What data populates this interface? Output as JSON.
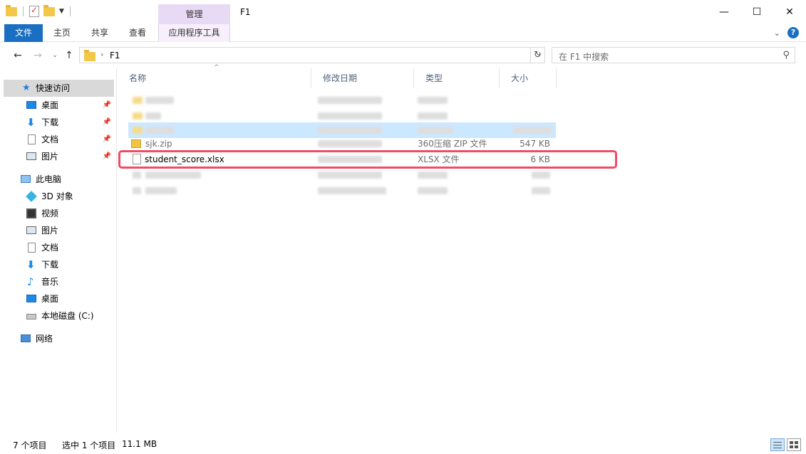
{
  "window": {
    "title": "F1",
    "manage_tab": "管理",
    "minimize": "—",
    "maximize": "☐",
    "close": "✕"
  },
  "ribbon": {
    "tabs": [
      "文件",
      "主页",
      "共享",
      "查看",
      "应用程序工具"
    ],
    "expand_icon": "chevron-down-icon",
    "help": "?"
  },
  "address": {
    "path_separator": "›",
    "path": "F1",
    "search_placeholder": "在 F1 中搜索"
  },
  "nav": {
    "quick_access": "快速访问",
    "quick_items": [
      "桌面",
      "下载",
      "文档",
      "图片"
    ],
    "this_pc": "此电脑",
    "pc_items": [
      "3D 对象",
      "视频",
      "图片",
      "文档",
      "下载",
      "音乐",
      "桌面",
      "本地磁盘 (C:)"
    ],
    "network": "网络"
  },
  "columns": {
    "name": "名称",
    "date": "修改日期",
    "type": "类型",
    "size": "大小"
  },
  "files": {
    "zip": {
      "name": "sjk.zip",
      "type": "360压缩 ZIP 文件",
      "size": "547 KB"
    },
    "target": {
      "name": "student_score.xlsx",
      "type": "XLSX 文件",
      "size": "6 KB"
    }
  },
  "status": {
    "count": "7 个项目",
    "selected": "选中 1 个项目",
    "size": "11.1 MB"
  },
  "colors": {
    "accent": "#1a6fc2",
    "manage_tab": "#e8d9f5",
    "highlight_box": "#ef4d63",
    "row_highlight": "#cce8ff"
  }
}
